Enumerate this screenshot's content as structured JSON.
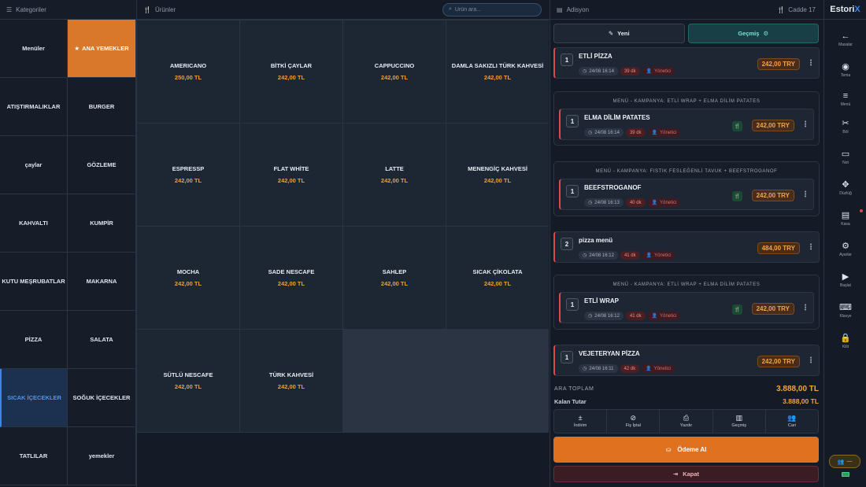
{
  "categories_header": {
    "icon": "list-icon",
    "title": "Kategoriler"
  },
  "categories": [
    {
      "label": "Menüler",
      "state": "normal"
    },
    {
      "label": "ANA YEMEKLER",
      "state": "featured",
      "icon": "star-icon"
    },
    {
      "label": "ATIŞTIRMALIKLAR",
      "state": "normal"
    },
    {
      "label": "BURGER",
      "state": "normal"
    },
    {
      "label": "çaylar",
      "state": "normal"
    },
    {
      "label": "GÖZLEME",
      "state": "normal"
    },
    {
      "label": "KAHVALTI",
      "state": "normal"
    },
    {
      "label": "KUMPİR",
      "state": "normal"
    },
    {
      "label": "KUTU MEŞRUBATLAR",
      "state": "normal"
    },
    {
      "label": "MAKARNA",
      "state": "normal"
    },
    {
      "label": "PİZZA",
      "state": "normal"
    },
    {
      "label": "SALATA",
      "state": "normal"
    },
    {
      "label": "SICAK İÇECEKLER",
      "state": "selected"
    },
    {
      "label": "SOĞUK İÇECEKLER",
      "state": "normal"
    },
    {
      "label": "TATLILAR",
      "state": "normal"
    },
    {
      "label": "yemekler",
      "state": "normal"
    }
  ],
  "products_header": {
    "icon": "cutlery-icon",
    "title": "Ürünler",
    "search_placeholder": "Ürün ara..."
  },
  "products": [
    {
      "name": "AMERICANO",
      "price": "250,00 TL"
    },
    {
      "name": "BİTKİ ÇAYLAR",
      "price": "242,00 TL"
    },
    {
      "name": "CAPPUCCINO",
      "price": "242,00 TL"
    },
    {
      "name": "DAMLA SAKIZLI TÜRK KAHVESİ",
      "price": "242,00 TL"
    },
    {
      "name": "ESPRESSP",
      "price": "242,00 TL"
    },
    {
      "name": "FLAT WHİTE",
      "price": "242,00 TL"
    },
    {
      "name": "LATTE",
      "price": "242,00 TL"
    },
    {
      "name": "MENENGİÇ KAHVESİ",
      "price": "242,00 TL"
    },
    {
      "name": "MOCHA",
      "price": "242,00 TL"
    },
    {
      "name": "SADE NESCAFE",
      "price": "242,00 TL"
    },
    {
      "name": "SAHLEP",
      "price": "242,00 TL"
    },
    {
      "name": "SICAK ÇİKOLATA",
      "price": "242,00 TL"
    },
    {
      "name": "SÜTLÜ NESCAFE",
      "price": "242,00 TL"
    },
    {
      "name": "TÜRK KAHVESİ",
      "price": "242,00 TL"
    }
  ],
  "order_header": {
    "title": "Adisyon",
    "table_label": "Cadde 17",
    "title_icon": "receipt-icon",
    "table_icon": "cutlery-icon"
  },
  "order_buttons": {
    "new_label": "Yeni",
    "history_label": "Geçmiş"
  },
  "orders": [
    {
      "type": "item",
      "qty": "1",
      "name": "ETLİ PİZZA",
      "time": "24/08 16:14",
      "duration": "39 dk",
      "user": "Yönetici",
      "price": "242,00 TRY"
    },
    {
      "type": "menu",
      "menu_title": "MENÜ - KAMPANYA: ETLİ WRAP + ELMA DİLİM PATATES",
      "qty": "1",
      "name": "ELMA DİLİM PATATES",
      "time": "24/08 16:14",
      "duration": "39 dk",
      "user": "Yönetici",
      "price": "242,00 TRY"
    },
    {
      "type": "menu",
      "menu_title": "MENÜ - KAMPANYA: FISTIK FESLEĞENLİ TAVUK + BEEFSTROGANOF",
      "qty": "1",
      "name": "BEEFSTROGANOF",
      "time": "24/08 16:13",
      "duration": "40 dk",
      "user": "Yönetici",
      "price": "242,00 TRY"
    },
    {
      "type": "item",
      "qty": "2",
      "name": "pizza menü",
      "time": "24/08 16:12",
      "duration": "41 dk",
      "user": "Yönetici",
      "price": "484,00 TRY"
    },
    {
      "type": "menu",
      "menu_title": "MENÜ - KAMPANYA: ETLİ WRAP + ELMA DİLİM PATATES",
      "qty": "1",
      "name": "ETLİ WRAP",
      "time": "24/08 16:12",
      "duration": "41 dk",
      "user": "Yönetici",
      "price": "242,00 TRY"
    },
    {
      "type": "item",
      "qty": "1",
      "name": "VEJETERYAN PİZZA",
      "time": "24/08 16:11",
      "duration": "42 dk",
      "user": "Yönetici",
      "price": "242,00 TRY"
    }
  ],
  "totals": {
    "subtotal_label": "ARA TOPLAM",
    "subtotal_value": "3.888,00 TL",
    "remaining_label": "Kalan Tutar",
    "remaining_value": "3.888,00 TL"
  },
  "actions": [
    {
      "label": "İndirim",
      "icon": "plus-minus-icon"
    },
    {
      "label": "Fiş İptal",
      "icon": "cancel-icon"
    },
    {
      "label": "Yazdır",
      "icon": "printer-icon"
    },
    {
      "label": "Geçmiş",
      "icon": "history-icon"
    },
    {
      "label": "Cari",
      "icon": "users-icon"
    }
  ],
  "pay_label": "Ödeme Al",
  "close_label": "Kapat",
  "brand": {
    "part1": "Estori",
    "part2": "X"
  },
  "sidebar": [
    {
      "label": "Masalar",
      "icon": "arrow-left-icon"
    },
    {
      "label": "Tema",
      "icon": "palette-icon"
    },
    {
      "label": "Menü",
      "icon": "menu-icon"
    },
    {
      "label": "Böl",
      "icon": "scissors-icon"
    },
    {
      "label": "Not",
      "icon": "note-icon"
    },
    {
      "label": "Düzlüğ",
      "icon": "move-icon"
    },
    {
      "label": "Kasa",
      "icon": "document-icon"
    },
    {
      "label": "Ayarlar",
      "icon": "gear-icon"
    },
    {
      "label": "Başlat",
      "icon": "play-icon"
    },
    {
      "label": "Klavye",
      "icon": "keyboard-icon"
    },
    {
      "label": "Kilit",
      "icon": "lock-icon"
    }
  ],
  "user_status": "—",
  "colors": {
    "accent": "#e0721f",
    "price": "#eca03b",
    "selected": "#3d86ee",
    "danger": "#e04848"
  }
}
